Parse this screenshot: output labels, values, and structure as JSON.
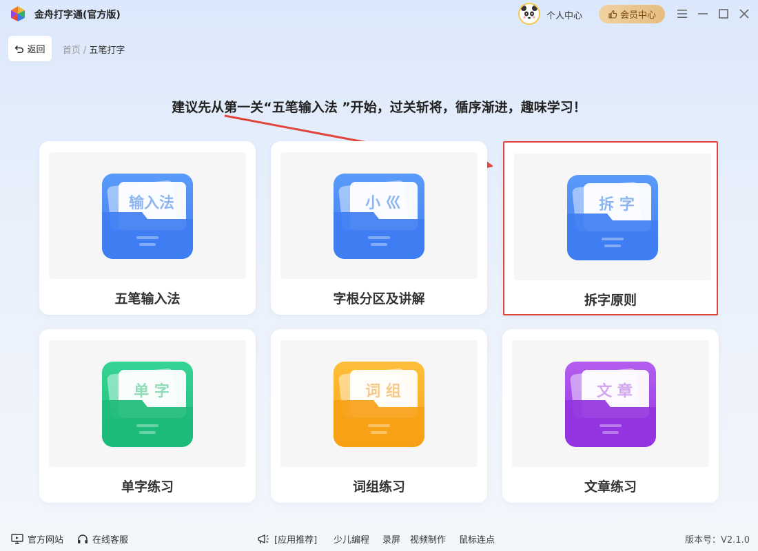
{
  "window": {
    "title": "金舟打字通(官方版)",
    "personal_center": "个人中心",
    "vip_center": "会员中心"
  },
  "nav": {
    "back_label": "返回",
    "breadcrumb": [
      "首页",
      "五笔打字"
    ]
  },
  "hint": "建议先从第一关“五笔输入法 ”开始，过关斩将，循序渐进，趣味学习！",
  "cards": [
    {
      "label": "五笔输入法",
      "folder_text": "输入法",
      "color_top": "#5a9af8",
      "color_bottom": "#3f7ef2",
      "text_color": "#8fb6f0"
    },
    {
      "label": "字根分区及讲解",
      "folder_text": "小 巛",
      "color_top": "#5a9af8",
      "color_bottom": "#3f7ef2",
      "text_color": "#8fb6f0"
    },
    {
      "label": "拆字原则",
      "folder_text": "拆 字",
      "color_top": "#5a9af8",
      "color_bottom": "#3f7ef2",
      "text_color": "#8fb6f0",
      "selected": true
    },
    {
      "label": "单字练习",
      "folder_text": "单 字",
      "color_top": "#36d495",
      "color_bottom": "#1dbb7a",
      "text_color": "#8fdcb9"
    },
    {
      "label": "词组练习",
      "folder_text": "词 组",
      "color_top": "#ffbf3a",
      "color_bottom": "#f7a016",
      "text_color": "#f5c98a"
    },
    {
      "label": "文章练习",
      "folder_text": "文 章",
      "color_top": "#b45ef0",
      "color_bottom": "#9334e0",
      "text_color": "#d1a8f0"
    }
  ],
  "footer": {
    "official_site": "官方网站",
    "online_service": "在线客服",
    "recommend": "[应用推荐]",
    "links": [
      "少儿编程",
      "录屏",
      "视频制作",
      "鼠标连点"
    ],
    "version": "版本号：V2.1.0"
  }
}
